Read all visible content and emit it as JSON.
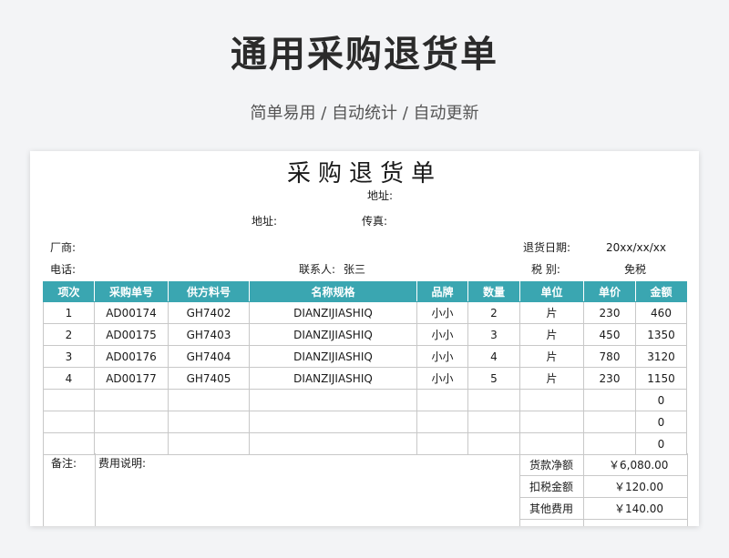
{
  "hero": {
    "title": "通用采购退货单",
    "subtitle": "简单易用 / 自动统计 / 自动更新"
  },
  "doc": {
    "title": "采购退货单",
    "address_top_label": "地址:",
    "address_label": "地址:",
    "fax_label": "传真:",
    "vendor_label": "厂商:",
    "phone_label": "电话:",
    "contact_label": "联系人:",
    "contact_value": "张三",
    "return_date_label": "退货日期:",
    "return_date_value": "20xx/xx/xx",
    "tax_label": "税 别:",
    "tax_value": "免税"
  },
  "table": {
    "headers": [
      "项次",
      "采购单号",
      "供方料号",
      "名称规格",
      "品牌",
      "数量",
      "单位",
      "单价",
      "金额"
    ],
    "rows": [
      [
        "1",
        "AD00174",
        "GH7402",
        "DIANZIJIASHIQ",
        "小小",
        "2",
        "片",
        "230",
        "460"
      ],
      [
        "2",
        "AD00175",
        "GH7403",
        "DIANZIJIASHIQ",
        "小小",
        "3",
        "片",
        "450",
        "1350"
      ],
      [
        "3",
        "AD00176",
        "GH7404",
        "DIANZIJIASHIQ",
        "小小",
        "4",
        "片",
        "780",
        "3120"
      ],
      [
        "4",
        "AD00177",
        "GH7405",
        "DIANZIJIASHIQ",
        "小小",
        "5",
        "片",
        "230",
        "1150"
      ],
      [
        "",
        "",
        "",
        "",
        "",
        "",
        "",
        "",
        "0"
      ],
      [
        "",
        "",
        "",
        "",
        "",
        "",
        "",
        "",
        "0"
      ],
      [
        "",
        "",
        "",
        "",
        "",
        "",
        "",
        "",
        "0"
      ]
    ]
  },
  "footer": {
    "remarks_label": "备注:",
    "fee_note_label": "费用说明:",
    "summary": [
      {
        "label": "货款净额",
        "value": "￥6,080.00"
      },
      {
        "label": "扣税金额",
        "value": "￥120.00"
      },
      {
        "label": "其他费用",
        "value": "￥140.00"
      }
    ]
  }
}
